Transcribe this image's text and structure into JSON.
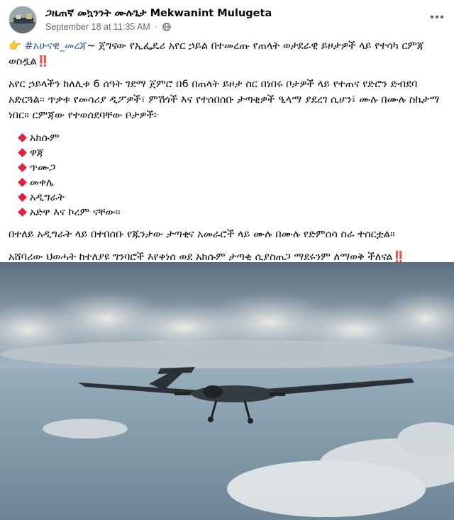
{
  "post": {
    "author": "ጋዜጠኛ መኳንንት ሙሉጌታ Mekwanint Mulugeta",
    "date": "September 18 at 11:35 AM",
    "separator": "·",
    "audience_icon": "globe-icon",
    "menu_icon": "more-horizontal-icon",
    "intro_hashtag": "#አሁናዊ_መረጃ",
    "intro_text": "~ ጀግናው የኢፌዴሪ አየር ኃይል በተመረጡ የጠላት ወታደራዊ ይዞታዎች ላይ የተሳካ ርምጃ ወስዷል",
    "bang": "‼️",
    "paragraph2": "አየር ኃይላችን ከለሊቱ 6 ሰዓት ገደማ ጀምሮ በ6 በጠላት ይዞታ ስር በነበሩ ቦታዎች ላይ የተጠና የድሮን ድብደባ አድርጓል። ጥቃቱ የመሳሪያ ዲፖዎች፣ ምሽጎች እና የተሰበሰቡ ታጣቂዎች ዒላማ ያደረገ ሲሆን፤ ሙሉ በሙሉ ስኬታማ ነበር። ርምጃው የተወሰደባቸው ቦታዎች፦",
    "places": [
      "አክሱም",
      "ዋጃ",
      "ጥሙጋ",
      "መቀሌ",
      "አዲግራት",
      "አድዋ እና ኮረም ናቸው።"
    ],
    "paragraph3": "በተለይ አዲግራት ላይ በተበሰቡ የጁንታው ታጣቂና አመራሮች ላይ ሙሉ በሙሉ የድምሰሳ ስራ ተሰርቷል።",
    "paragraph4": "አሸባሪው ህወሓት ከተለያዩ ግንባሮች እየቀነሰ ወደ አክሱም ታጣቂ ሲያስጠጋ ማደሩንም ለማወቅ ችለናል",
    "image_icon": "drone-photo"
  },
  "colors": {
    "hashtag": "#385898",
    "meta": "#65676b",
    "bullet": "#e8213b",
    "bang": "#e0245e"
  }
}
